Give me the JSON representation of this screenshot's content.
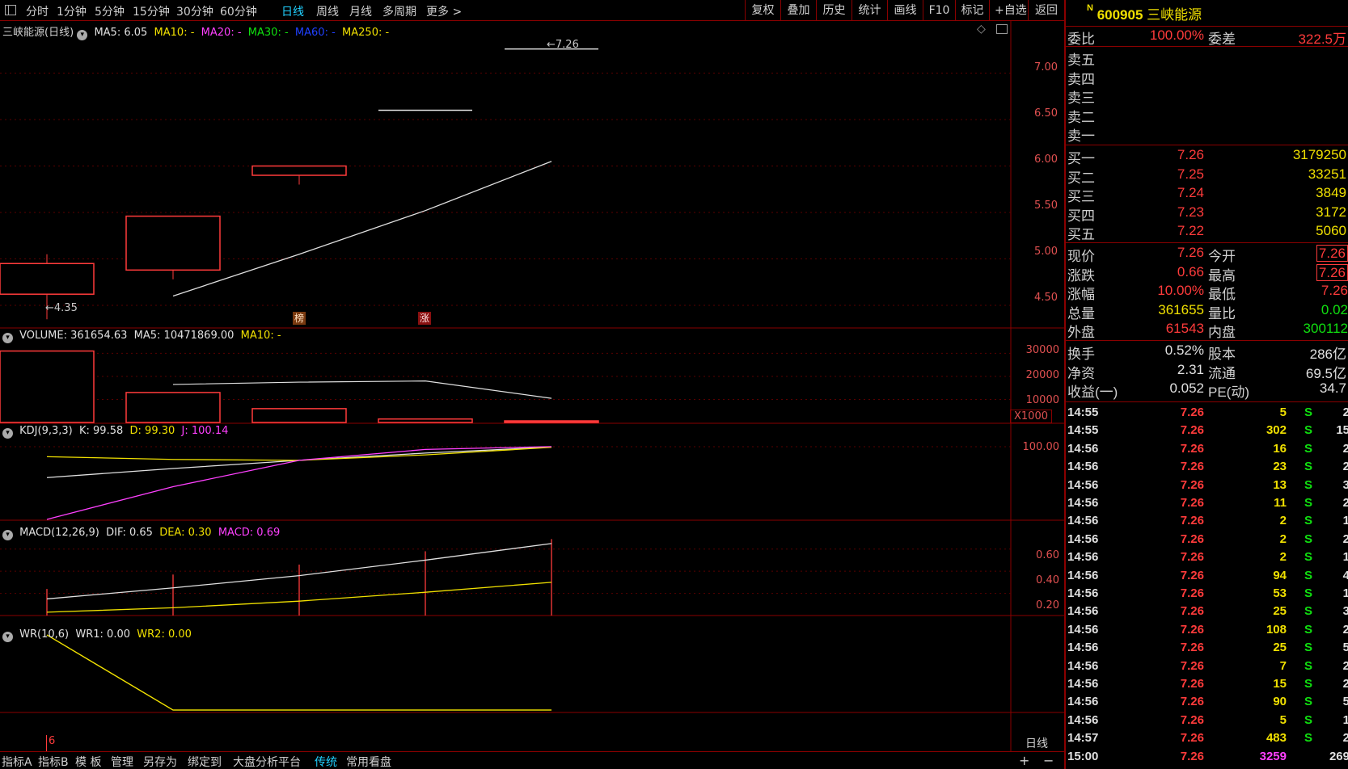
{
  "toolbar": {
    "periods": [
      "分时",
      "1分钟",
      "5分钟",
      "15分钟",
      "30分钟",
      "60分钟",
      "日线",
      "周线",
      "月线",
      "多周期",
      "更多 >"
    ],
    "active_period": "日线",
    "buttons": [
      "复权",
      "叠加",
      "历史",
      "统计",
      "画线",
      "F10",
      "标记",
      "+自选",
      "返回"
    ]
  },
  "main_pane": {
    "title": "三峡能源(日线)",
    "ma5": "MA5: 6.05",
    "ma10": "MA10: -",
    "ma20": "MA20: -",
    "ma30": "MA30: -",
    "ma60": "MA60: -",
    "ma250": "MA250: -",
    "high_marker": "7.26",
    "low_marker": "4.35",
    "badge1": "榜",
    "badge2": "涨",
    "y_ticks": [
      "7.00",
      "6.50",
      "6.00",
      "5.50",
      "5.00",
      "4.50"
    ]
  },
  "volume_pane": {
    "label": "VOLUME: 361654.63",
    "ma5": "MA5: 10471869.00",
    "ma10": "MA10: -",
    "y_ticks": [
      "30000",
      "20000",
      "10000"
    ],
    "unit": "X1000"
  },
  "kdj_pane": {
    "label": "KDJ(9,3,3)",
    "k": "K: 99.58",
    "d": "D: 99.30",
    "j": "J: 100.14",
    "y_ticks": [
      "100.00"
    ]
  },
  "macd_pane": {
    "label": "MACD(12,26,9)",
    "dif": "DIF: 0.65",
    "dea": "DEA: 0.30",
    "macd": "MACD: 0.69",
    "y_ticks": [
      "0.60",
      "0.40",
      "0.20"
    ]
  },
  "wr_pane": {
    "label": "WR(10,6)",
    "wr1": "WR1: 0.00",
    "wr2": "WR2: 0.00"
  },
  "bottom": {
    "marker": "6",
    "period_label": "日线",
    "tabs": [
      "指标A",
      "指标B",
      "模 板",
      "管理",
      "另存为",
      "绑定到",
      "大盘分析平台",
      "传统",
      "常用看盘"
    ],
    "active_tab": "传统",
    "plus": "+",
    "minus": "−"
  },
  "quote": {
    "badge": "N",
    "code": "600905",
    "name": "三峡能源",
    "weibi_label": "委比",
    "weibi": "100.00%",
    "weicha_label": "委差",
    "weicha": "322.5万",
    "asks": [
      {
        "label": "卖五",
        "price": "",
        "vol": ""
      },
      {
        "label": "卖四",
        "price": "",
        "vol": ""
      },
      {
        "label": "卖三",
        "price": "",
        "vol": ""
      },
      {
        "label": "卖二",
        "price": "",
        "vol": ""
      },
      {
        "label": "卖一",
        "price": "",
        "vol": ""
      }
    ],
    "bids": [
      {
        "label": "买一",
        "price": "7.26",
        "vol": "3179250"
      },
      {
        "label": "买二",
        "price": "7.25",
        "vol": "33251"
      },
      {
        "label": "买三",
        "price": "7.24",
        "vol": "3849"
      },
      {
        "label": "买四",
        "price": "7.23",
        "vol": "3172"
      },
      {
        "label": "买五",
        "price": "7.22",
        "vol": "5060"
      }
    ],
    "stats1": [
      {
        "l1": "现价",
        "v1": "7.26",
        "l2": "今开",
        "v2": "7.26"
      },
      {
        "l1": "涨跌",
        "v1": "0.66",
        "l2": "最高",
        "v2": "7.26"
      },
      {
        "l1": "涨幅",
        "v1": "10.00%",
        "l2": "最低",
        "v2": "7.26"
      },
      {
        "l1": "总量",
        "v1": "361655",
        "l2": "量比",
        "v2": "0.02"
      },
      {
        "l1": "外盘",
        "v1": "61543",
        "l2": "内盘",
        "v2": "300112"
      }
    ],
    "stats2": [
      {
        "l1": "换手",
        "v1": "0.52%",
        "l2": "股本",
        "v2": "286亿"
      },
      {
        "l1": "净资",
        "v1": "2.31",
        "l2": "流通",
        "v2": "69.5亿"
      },
      {
        "l1": "收益(一)",
        "v1": "0.052",
        "l2": "PE(动)",
        "v2": "34.7"
      }
    ]
  },
  "ticks": [
    {
      "time": "14:55",
      "price": "7.26",
      "vol": "5",
      "side": "S",
      "n": "2"
    },
    {
      "time": "14:55",
      "price": "7.26",
      "vol": "302",
      "side": "S",
      "n": "15"
    },
    {
      "time": "14:56",
      "price": "7.26",
      "vol": "16",
      "side": "S",
      "n": "2"
    },
    {
      "time": "14:56",
      "price": "7.26",
      "vol": "23",
      "side": "S",
      "n": "2"
    },
    {
      "time": "14:56",
      "price": "7.26",
      "vol": "13",
      "side": "S",
      "n": "3"
    },
    {
      "time": "14:56",
      "price": "7.26",
      "vol": "11",
      "side": "S",
      "n": "2"
    },
    {
      "time": "14:56",
      "price": "7.26",
      "vol": "2",
      "side": "S",
      "n": "1"
    },
    {
      "time": "14:56",
      "price": "7.26",
      "vol": "2",
      "side": "S",
      "n": "2"
    },
    {
      "time": "14:56",
      "price": "7.26",
      "vol": "2",
      "side": "S",
      "n": "1"
    },
    {
      "time": "14:56",
      "price": "7.26",
      "vol": "94",
      "side": "S",
      "n": "4"
    },
    {
      "time": "14:56",
      "price": "7.26",
      "vol": "53",
      "side": "S",
      "n": "1"
    },
    {
      "time": "14:56",
      "price": "7.26",
      "vol": "25",
      "side": "S",
      "n": "3"
    },
    {
      "time": "14:56",
      "price": "7.26",
      "vol": "108",
      "side": "S",
      "n": "2"
    },
    {
      "time": "14:56",
      "price": "7.26",
      "vol": "25",
      "side": "S",
      "n": "5"
    },
    {
      "time": "14:56",
      "price": "7.26",
      "vol": "7",
      "side": "S",
      "n": "2"
    },
    {
      "time": "14:56",
      "price": "7.26",
      "vol": "15",
      "side": "S",
      "n": "2"
    },
    {
      "time": "14:56",
      "price": "7.26",
      "vol": "90",
      "side": "S",
      "n": "5"
    },
    {
      "time": "14:56",
      "price": "7.26",
      "vol": "5",
      "side": "S",
      "n": "1"
    },
    {
      "time": "14:57",
      "price": "7.26",
      "vol": "483",
      "side": "S",
      "n": "2"
    },
    {
      "time": "15:00",
      "price": "7.26",
      "vol": "3259",
      "side": "",
      "n": "269"
    }
  ],
  "colors": {
    "up": "#ff3b3b",
    "grid": "#8a0000",
    "ma5": "#e0e0e0",
    "ma10": "#f0e000",
    "ma20": "#ff40ff",
    "ma30": "#10e010",
    "ma60": "#2040ff",
    "active": "#20d0ff"
  },
  "chart_data": {
    "type": "candlestick",
    "candles": [
      {
        "open": 4.62,
        "close": 4.95,
        "high": 5.05,
        "low": 4.35
      },
      {
        "open": 4.88,
        "close": 5.46,
        "high": 5.46,
        "low": 4.78
      },
      {
        "open": 5.9,
        "close": 6.0,
        "high": 6.0,
        "low": 5.8
      },
      {
        "open": 6.6,
        "close": 6.6,
        "high": 6.6,
        "low": 6.6
      },
      {
        "open": 7.26,
        "close": 7.26,
        "high": 7.26,
        "low": 7.26
      }
    ],
    "ma5": [
      null,
      4.6,
      5.05,
      5.52,
      6.05
    ],
    "volume": [
      31000,
      13000,
      6000,
      1500,
      361.65
    ],
    "volume_ma5": [
      null,
      16500,
      17500,
      18000,
      10471.869
    ],
    "kdj": {
      "k": [
        66,
        76,
        85,
        93,
        99.58
      ],
      "d": [
        89,
        86,
        85,
        91,
        99.3
      ],
      "j": [
        20,
        56,
        85,
        97,
        100.14
      ]
    },
    "macd": {
      "dif": [
        0.15,
        0.25,
        0.36,
        0.5,
        0.65
      ],
      "dea": [
        0.03,
        0.07,
        0.13,
        0.21,
        0.3
      ],
      "hist": [
        0.24,
        0.37,
        0.46,
        0.58,
        0.69
      ]
    },
    "wr": {
      "wr1": [
        100,
        0,
        0,
        0,
        0
      ],
      "wr2": [
        100,
        0,
        0,
        0,
        0
      ]
    },
    "price_axis": [
      4.3,
      7.3
    ]
  }
}
